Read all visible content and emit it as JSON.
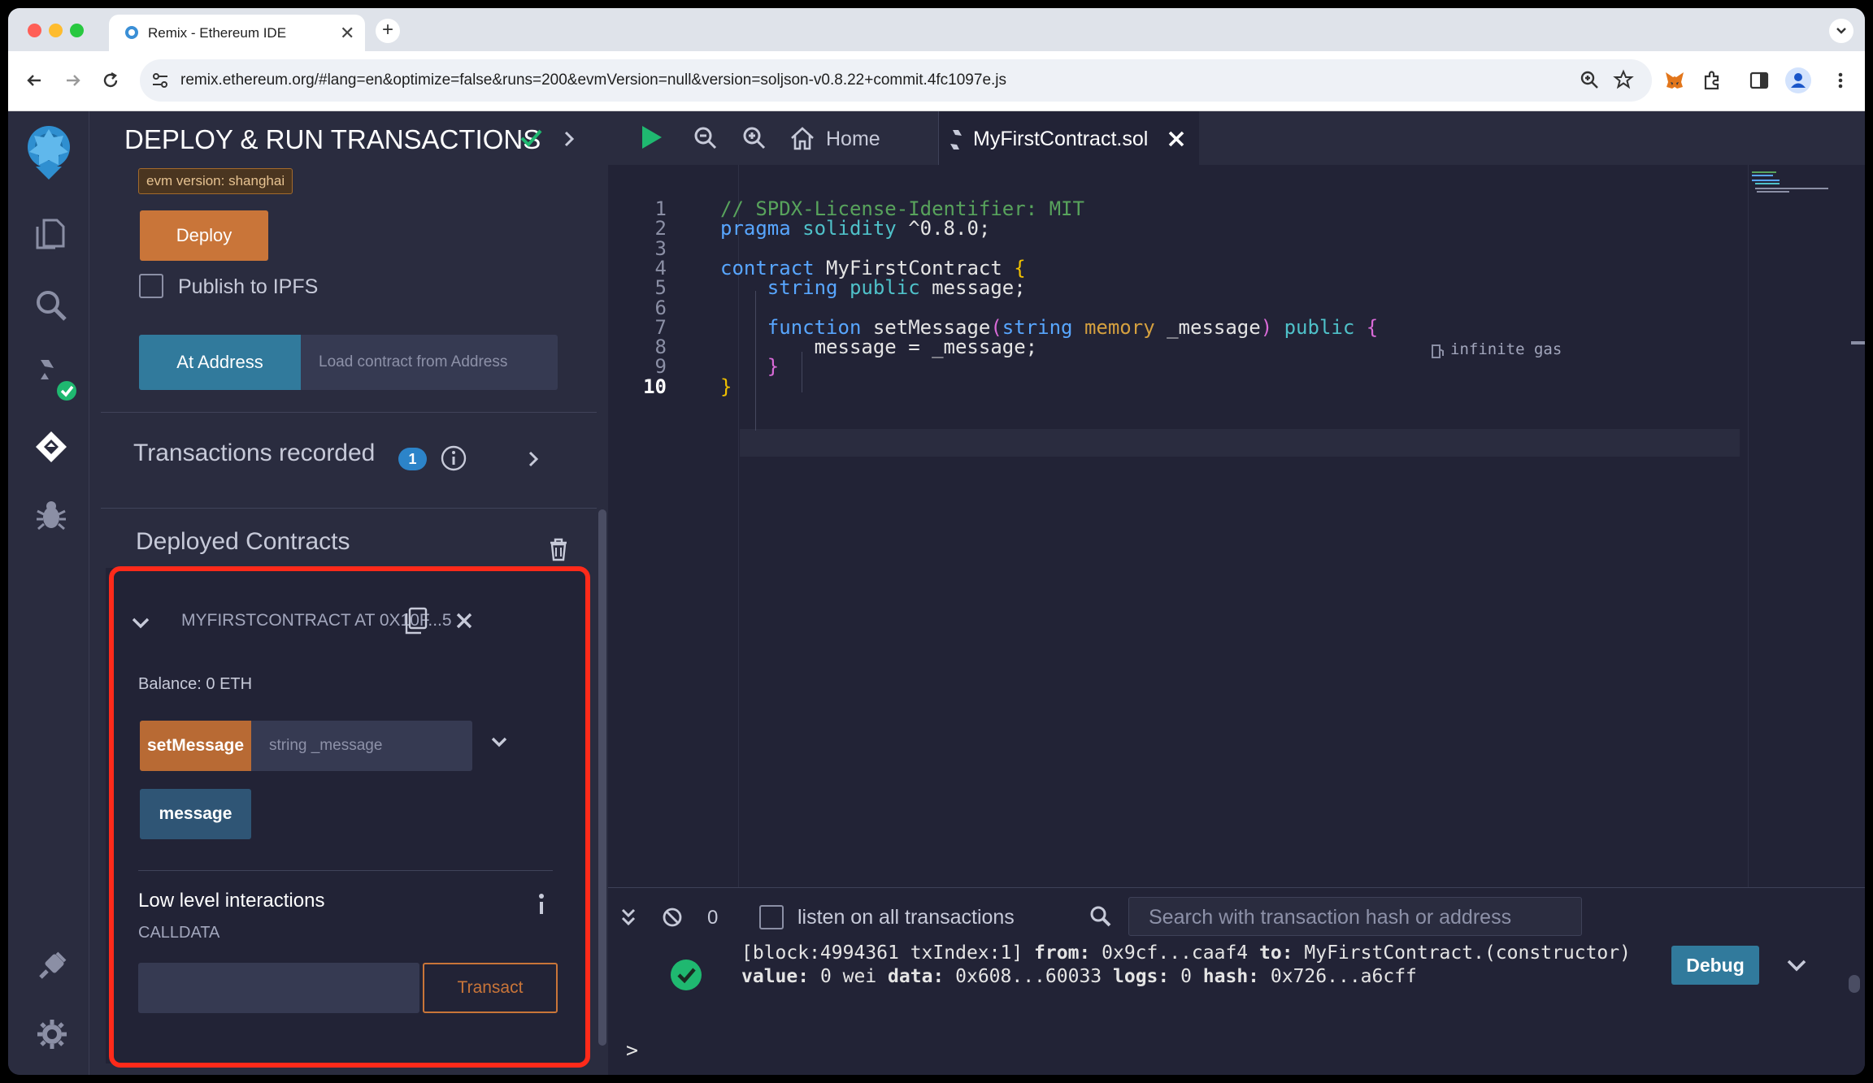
{
  "browser": {
    "tab_title": "Remix - Ethereum IDE",
    "url": "remix.ethereum.org/#lang=en&optimize=false&runs=200&evmVersion=null&version=soljson-v0.8.22+commit.4fc1097e.js"
  },
  "side_panel": {
    "title": "DEPLOY & RUN TRANSACTIONS",
    "evm_badge": "evm version: shanghai",
    "deploy_label": "Deploy",
    "publish_ipfs_label": "Publish to IPFS",
    "at_address_label": "At Address",
    "load_contract_placeholder": "Load contract from Address",
    "transactions_recorded_label": "Transactions recorded",
    "transactions_recorded_count": "1",
    "deployed_contracts_label": "Deployed Contracts",
    "contract": {
      "name": "MYFIRSTCONTRACT AT 0X10F...5",
      "balance": "Balance: 0 ETH",
      "set_message_label": "setMessage",
      "set_message_placeholder": "string _message",
      "message_label": "message",
      "low_level_label": "Low level interactions",
      "calldata_label": "CALLDATA",
      "transact_label": "Transact"
    }
  },
  "editor": {
    "tabs": [
      {
        "label": "Home"
      },
      {
        "label": "MyFirstContract.sol"
      }
    ],
    "gas_hint": "infinite gas",
    "lines": [
      {
        "n": "1",
        "tokens": [
          {
            "t": "// SPDX-License-Identifier: MIT",
            "c": "cmt"
          }
        ]
      },
      {
        "n": "2",
        "tokens": [
          {
            "t": "pragma ",
            "c": "kw"
          },
          {
            "t": "solidity",
            "c": "type"
          },
          {
            "t": " ^0.8.0;",
            "c": "id"
          }
        ]
      },
      {
        "n": "3",
        "tokens": []
      },
      {
        "n": "4",
        "tokens": [
          {
            "t": "contract ",
            "c": "kw"
          },
          {
            "t": "MyFirstContract ",
            "c": "id"
          },
          {
            "t": "{",
            "c": "br1"
          }
        ]
      },
      {
        "n": "5",
        "tokens": [
          {
            "t": "    ",
            "c": "id"
          },
          {
            "t": "string ",
            "c": "kw"
          },
          {
            "t": "public ",
            "c": "type"
          },
          {
            "t": "message;",
            "c": "id"
          }
        ]
      },
      {
        "n": "6",
        "tokens": []
      },
      {
        "n": "7",
        "tokens": [
          {
            "t": "    ",
            "c": "id"
          },
          {
            "t": "function ",
            "c": "kw"
          },
          {
            "t": "setMessage",
            "c": "id"
          },
          {
            "t": "(",
            "c": "br2"
          },
          {
            "t": "string ",
            "c": "kw"
          },
          {
            "t": "memory ",
            "c": "mem"
          },
          {
            "t": "_message",
            "c": "id"
          },
          {
            "t": ") ",
            "c": "br2"
          },
          {
            "t": "public ",
            "c": "type"
          },
          {
            "t": "{",
            "c": "br2"
          }
        ]
      },
      {
        "n": "8",
        "tokens": [
          {
            "t": "        message = _message;",
            "c": "id"
          }
        ]
      },
      {
        "n": "9",
        "tokens": [
          {
            "t": "    ",
            "c": "id"
          },
          {
            "t": "}",
            "c": "br2"
          }
        ]
      },
      {
        "n": "10",
        "tokens": [
          {
            "t": "}",
            "c": "br1"
          }
        ]
      }
    ]
  },
  "terminal": {
    "pending_count": "0",
    "listen_label": "listen on all transactions",
    "search_placeholder": "Search with transaction hash or address",
    "log_line1": [
      {
        "t": "[block:4994361 txIndex:1] ",
        "b": false
      },
      {
        "t": "from: ",
        "b": true
      },
      {
        "t": "0x9cf...caaf4 ",
        "b": false
      },
      {
        "t": "to: ",
        "b": true
      },
      {
        "t": "MyFirstContract.(constructor)",
        "b": false
      }
    ],
    "log_line2": [
      {
        "t": "value: ",
        "b": true
      },
      {
        "t": "0 wei ",
        "b": false
      },
      {
        "t": "data: ",
        "b": true
      },
      {
        "t": "0x608...60033 ",
        "b": false
      },
      {
        "t": "logs: ",
        "b": true
      },
      {
        "t": "0 ",
        "b": false
      },
      {
        "t": "hash: ",
        "b": true
      },
      {
        "t": "0x726...a6cff",
        "b": false
      }
    ],
    "debug_label": "Debug",
    "prompt": ">"
  }
}
